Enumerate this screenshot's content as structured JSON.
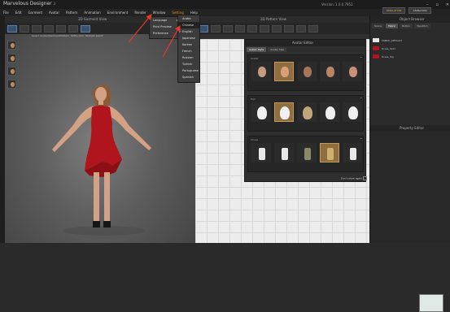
{
  "app": {
    "title": "Marvelous Designer",
    "version_badge": "3",
    "version_label": "Version:",
    "version_value": "1.0.0.7952"
  },
  "menu": [
    "File",
    "Edit",
    "Garment",
    "Avatar",
    "Pattern",
    "Animation",
    "Environment",
    "Render",
    "Window",
    "Setting",
    "Help"
  ],
  "settings_menu": [
    "Language",
    "Print Preview",
    "Preference"
  ],
  "language_menu": {
    "items": [
      "Arabic",
      "Chinese",
      "English",
      "Japanese",
      "Korean",
      "French",
      "Russian",
      "Turkish",
      "Portuguese",
      "Spanish"
    ],
    "highlighted": "Chinese",
    "checked": "English"
  },
  "viewport3d": {
    "title": "3D Garment View",
    "status": "Select Avatar/Garment/Pattern. Shift+click: Multiple select"
  },
  "viewport2d": {
    "title": "2D Pattern View"
  },
  "library": {
    "title": "Avatar Editor",
    "tabs": [
      "Avatar Style",
      "Avatar Size"
    ],
    "sections": [
      "Avatar",
      "Hair",
      "Shoes"
    ],
    "footer": "Don't show again"
  },
  "object_browser": {
    "title": "Object Browser",
    "tabs": [
      "Scene",
      "Fabric",
      "Button",
      "Topstitch"
    ],
    "items": [
      {
        "label": "FABRIC_DEFAULT",
        "color": "#e6e6e6"
      },
      {
        "label": "Dress_Skirt",
        "color": "#b0141c"
      },
      {
        "label": "Dress_Top",
        "color": "#b0141c"
      }
    ]
  },
  "property_editor": {
    "title": "Property Editor"
  },
  "toolbar": {
    "simulation": "SIMULATION",
    "animation": "ANIMATION"
  },
  "colors": {
    "accent": "#f08a1a",
    "dress": "#b0141c",
    "annotation_arrow": "#e5392b"
  },
  "icons": [
    "minimize-icon",
    "maximize-icon",
    "close-icon",
    "submenu-arrow-icon",
    "checkmark-icon",
    "collapse-icon"
  ]
}
